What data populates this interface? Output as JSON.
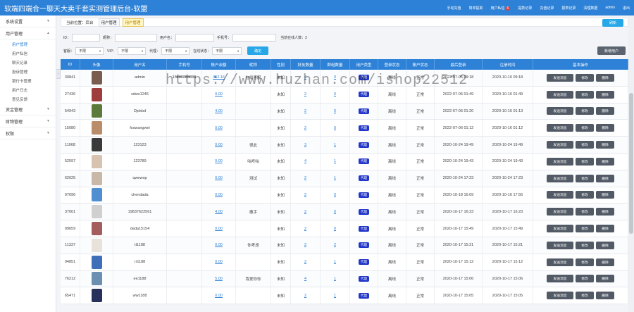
{
  "app": {
    "title": "软端四端合一聊天大卖千套实测管理后台-软盟"
  },
  "top_nav": [
    {
      "label": "手动充值"
    },
    {
      "label": "简单提取"
    },
    {
      "label": "用户私信",
      "badge": "6"
    },
    {
      "label": "提款记录"
    },
    {
      "label": "充值记录"
    },
    {
      "label": "报表记录"
    },
    {
      "label": "清理数据"
    },
    {
      "label": "admin"
    },
    {
      "label": "退出"
    }
  ],
  "sidebar": {
    "groups": [
      {
        "label": "系统设置"
      },
      {
        "label": "用户管理"
      },
      {
        "label": "资金管理"
      },
      {
        "label": "财物管理"
      },
      {
        "label": "权限"
      }
    ],
    "user_subitems": [
      {
        "label": "用户管理"
      },
      {
        "label": "用户私信"
      },
      {
        "label": "聊天记录"
      },
      {
        "label": "投诉管理"
      },
      {
        "label": "银行卡管理"
      },
      {
        "label": "用户日志"
      },
      {
        "label": "意见反馈"
      }
    ]
  },
  "breadcrumb": {
    "prefix": "当前位置：后台",
    "items": [
      "用户管理",
      "用户管理"
    ],
    "refresh": "刷新"
  },
  "filters": {
    "id_label": "ID：",
    "nickname_label": "昵称：",
    "username_label": "用户名：",
    "phone_label": "手机号：",
    "online_label": "当前在线人数：2",
    "admin_label": "客服：",
    "admin_value": "不限",
    "vip_label": "VIP：",
    "vip_value": "不限",
    "agent_label": "代理：",
    "agent_value": "不限",
    "online_status_label": "在线状态：",
    "online_status_value": "不限",
    "confirm": "确定",
    "add_user": "新增用户"
  },
  "table": {
    "headers": [
      "ID",
      "头像",
      "用户名",
      "手机号",
      "账户余额",
      "昵称",
      "性别",
      "好友数量",
      "群组数量",
      "用户类型",
      "登录状态",
      "账户状态",
      "最后登录",
      "注册时间",
      "基本操作"
    ],
    "rows": [
      {
        "id": "30841",
        "username": "admin",
        "phone": "15888888888",
        "balance": "452.16",
        "nickname": "在线客服",
        "gender": "未知",
        "friends": "4",
        "groups": "0",
        "type": "代理",
        "login": "离线",
        "status": "正常",
        "last": "2022-07-06 09:18",
        "reg": "2020-10-10 09:18",
        "av": "#7a5d4f"
      },
      {
        "id": "27436",
        "username": "sdws1245",
        "phone": "",
        "balance": "0.00",
        "nickname": "",
        "gender": "未知",
        "friends": "2",
        "groups": "0",
        "type": "代理",
        "login": "离线",
        "status": "正常",
        "last": "2022-07-06 01:49",
        "reg": "2020-10-16 01:49",
        "av": "#9f3c3c"
      },
      {
        "id": "54943",
        "username": "Djdxbd",
        "phone": "",
        "balance": "4.00",
        "nickname": "",
        "gender": "未知",
        "friends": "2",
        "groups": "0",
        "type": "代理",
        "login": "离线",
        "status": "正常",
        "last": "2022-07-06 01:20",
        "reg": "2020-10-16 01:13",
        "av": "#5c7a3b"
      },
      {
        "id": "15080",
        "username": "fxswangwei",
        "phone": "",
        "balance": "0.00",
        "nickname": "",
        "gender": "未知",
        "friends": "2",
        "groups": "0",
        "type": "代理",
        "login": "离线",
        "status": "正常",
        "last": "2022-07-06 01:12",
        "reg": "2020-10-16 01:12",
        "av": "#b98c6a"
      },
      {
        "id": "11068",
        "username": "123123",
        "phone": "",
        "balance": "0.00",
        "nickname": "很此",
        "gender": "未知",
        "friends": "3",
        "groups": "1",
        "type": "代理",
        "login": "离线",
        "status": "正常",
        "last": "2020-10-24 19:49",
        "reg": "2020-10-24 19:49",
        "av": "#3a3a3a"
      },
      {
        "id": "52597",
        "username": "123789",
        "phone": "",
        "balance": "0.00",
        "nickname": "咕咚咕",
        "gender": "未知",
        "friends": "4",
        "groups": "1",
        "type": "代理",
        "login": "离线",
        "status": "正常",
        "last": "2020-10-24 19:43",
        "reg": "2020-10-24 19:43",
        "av": "#d8c2b0"
      },
      {
        "id": "62625",
        "username": "qwewop",
        "phone": "",
        "balance": "0.00",
        "nickname": "测试",
        "gender": "未知",
        "friends": "2",
        "groups": "1",
        "type": "代理",
        "login": "离线",
        "status": "正常",
        "last": "2020-10-24 17:23",
        "reg": "2020-10-24 17:23",
        "av": "#c9b8a8"
      },
      {
        "id": "97696",
        "username": "chendada",
        "phone": "",
        "balance": "0.00",
        "nickname": "",
        "gender": "未知",
        "friends": "2",
        "groups": "0",
        "type": "代理",
        "login": "离线",
        "status": "正常",
        "last": "2020-10-18 16:09",
        "reg": "2020-10-16 17:56",
        "av": "#4f8fd1"
      },
      {
        "id": "37001",
        "username": "19837622561",
        "phone": "",
        "balance": "4.00",
        "nickname": "撒手",
        "gender": "未知",
        "friends": "2",
        "groups": "0",
        "type": "代理",
        "login": "离线",
        "status": "正常",
        "last": "2020-10-17 16:23",
        "reg": "2020-10-17 16:23",
        "av": "#d0d0d0"
      },
      {
        "id": "99659",
        "username": "dada15154",
        "phone": "",
        "balance": "0.00",
        "nickname": "",
        "gender": "未知",
        "friends": "2",
        "groups": "0",
        "type": "代理",
        "login": "离线",
        "status": "正常",
        "last": "2020-10-17 15:49",
        "reg": "2020-10-17 15:49",
        "av": "#a35d5d"
      },
      {
        "id": "11337",
        "username": "tt1188",
        "phone": "",
        "balance": "0.00",
        "nickname": "你考虑",
        "gender": "未知",
        "friends": "2",
        "groups": "2",
        "type": "代理",
        "login": "离线",
        "status": "正常",
        "last": "2020-10-17 15:21",
        "reg": "2020-10-17 15:21",
        "av": "#e9e2da"
      },
      {
        "id": "94851",
        "username": "rr1188",
        "phone": "",
        "balance": "0.00",
        "nickname": "",
        "gender": "未知",
        "friends": "2",
        "groups": "1",
        "type": "代理",
        "login": "离线",
        "status": "正常",
        "last": "2020-10-17 15:12",
        "reg": "2020-10-17 15:12",
        "av": "#3e6fb8"
      },
      {
        "id": "76212",
        "username": "ee1188",
        "phone": "",
        "balance": "5.00",
        "nickname": "我爱你你",
        "gender": "未知",
        "friends": "4",
        "groups": "1",
        "type": "代理",
        "login": "离线",
        "status": "正常",
        "last": "2020-10-17 15:06",
        "reg": "2020-10-17 15:06",
        "av": "#6a8fb0"
      },
      {
        "id": "65471",
        "username": "ww1188",
        "phone": "",
        "balance": "0.00",
        "nickname": "",
        "gender": "未知",
        "friends": "2",
        "groups": "1",
        "type": "代理",
        "login": "离线",
        "status": "正常",
        "last": "2020-10-17 15:05",
        "reg": "2020-10-17 15:05",
        "av": "#27305a"
      }
    ],
    "actions": {
      "message": "发送消息",
      "edit": "修改",
      "delete": "删除"
    }
  },
  "watermark": "https://www.huzhan.com/ishop22512"
}
